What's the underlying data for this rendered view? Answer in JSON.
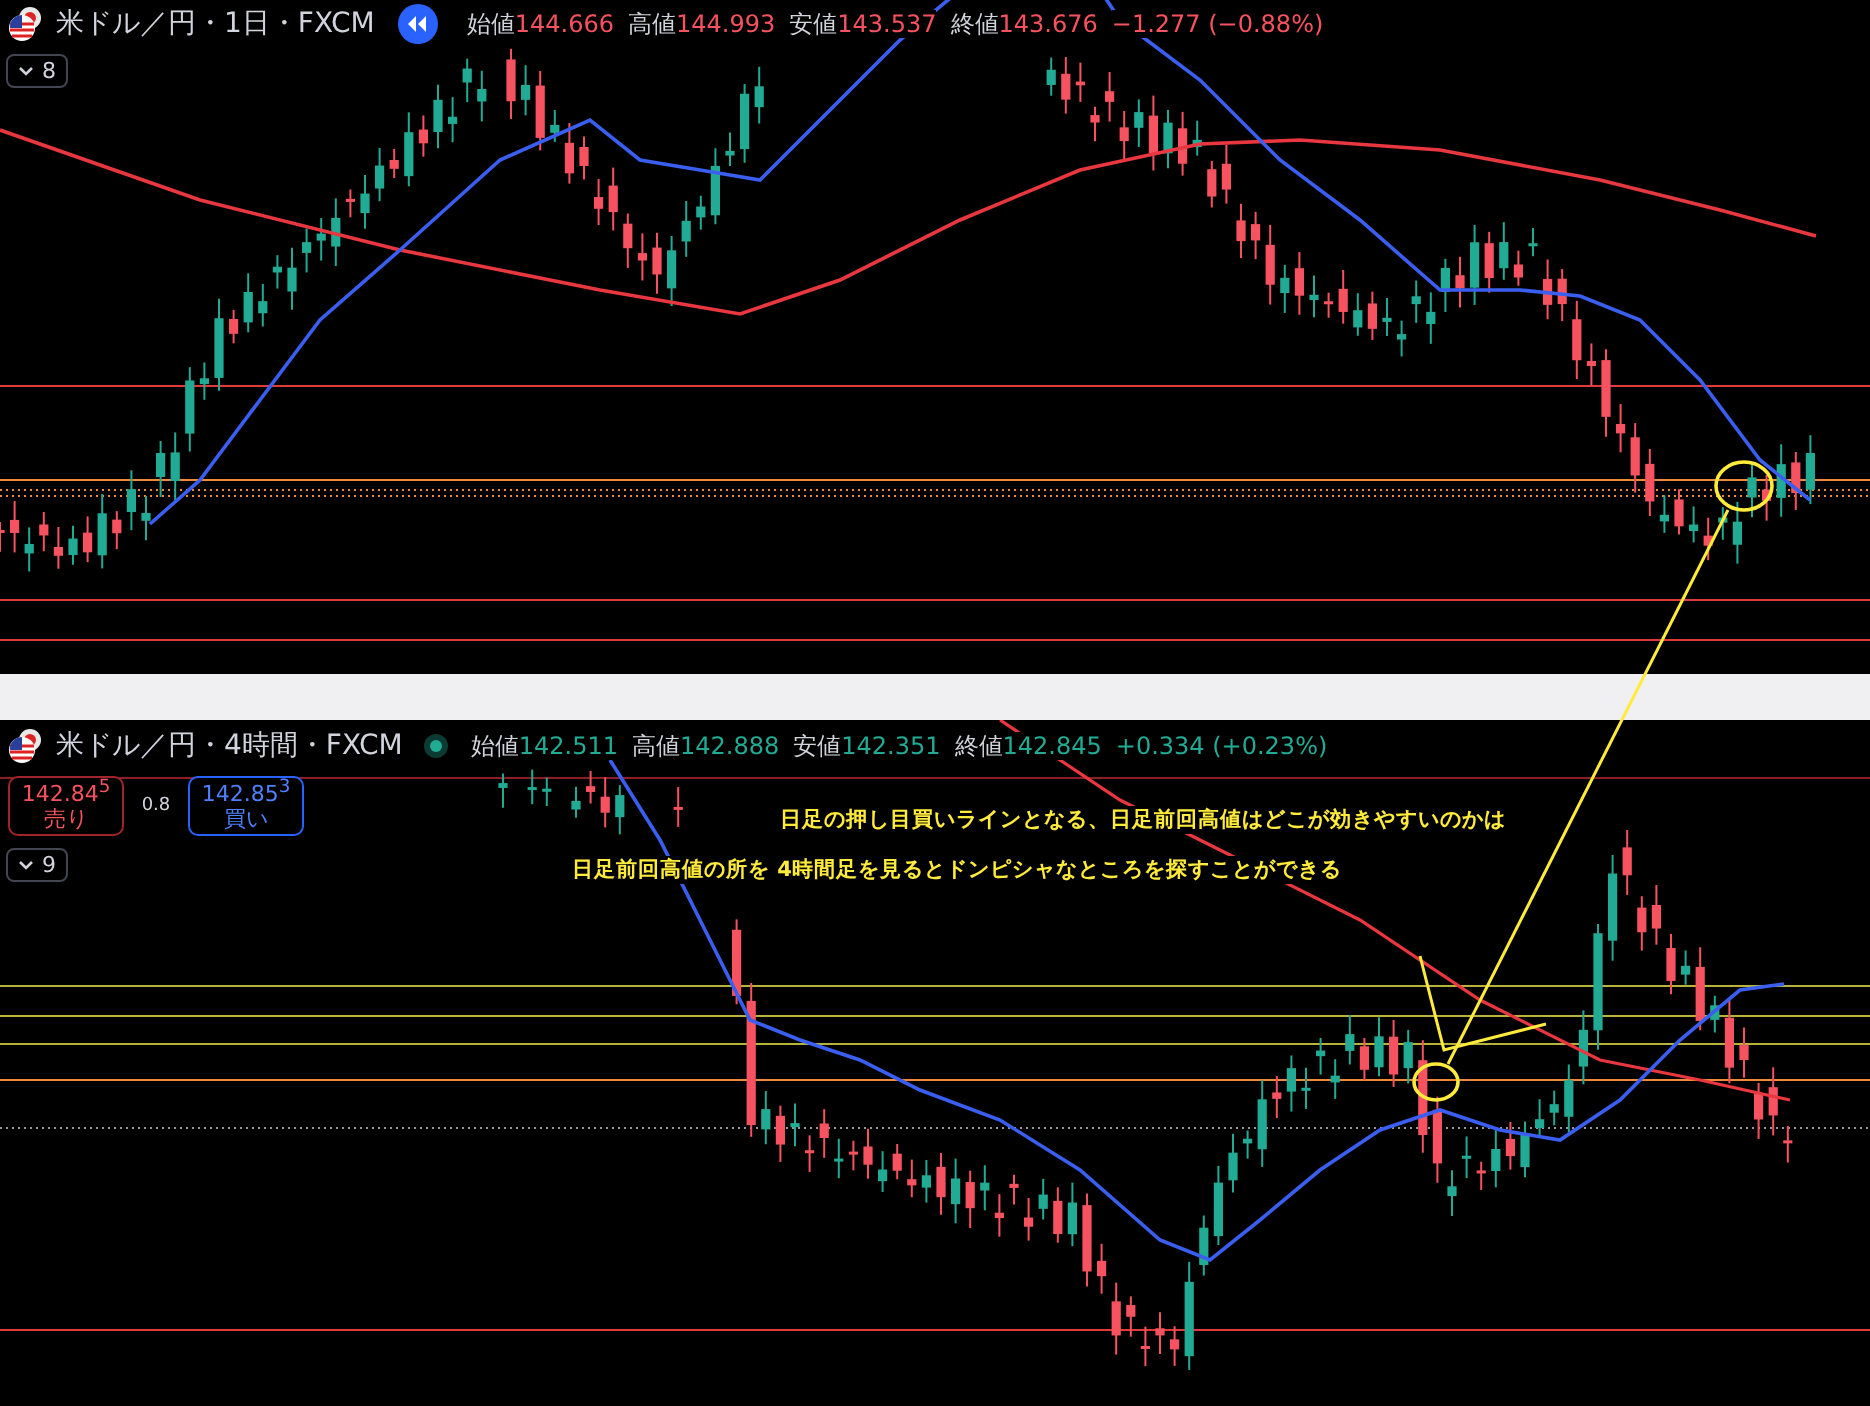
{
  "top_chart": {
    "title": "米ドル／円・1日・FXCM",
    "rising": false,
    "ohlc": [
      {
        "label": "始値",
        "value": "144.666"
      },
      {
        "label": "高値",
        "value": "144.993"
      },
      {
        "label": "安値",
        "value": "143.537"
      },
      {
        "label": "終値",
        "value": "143.676"
      }
    ],
    "change": "−1.277 (−0.88%)",
    "indicator_count": "8"
  },
  "bottom_chart": {
    "title": "米ドル／円・4時間・FXCM",
    "rising": true,
    "ohlc": [
      {
        "label": "始値",
        "value": "142.511"
      },
      {
        "label": "高値",
        "value": "142.888"
      },
      {
        "label": "安値",
        "value": "142.351"
      },
      {
        "label": "終値",
        "value": "142.845"
      }
    ],
    "change": "+0.334 (+0.23%)",
    "sell": {
      "price": "142.84$^{5}$",
      "label": "売り"
    },
    "spread": "0.8",
    "buy": {
      "price": "142.85$^{3}$",
      "label": "買い"
    },
    "indicator_count": "9",
    "annotations": [
      "日足の押し目買いラインとなる、日足前回高値はどこが効きやすいのかは",
      "日足前回高値の所を 4時間足を見るとドンピシャなところを探すことができる"
    ]
  }
}
